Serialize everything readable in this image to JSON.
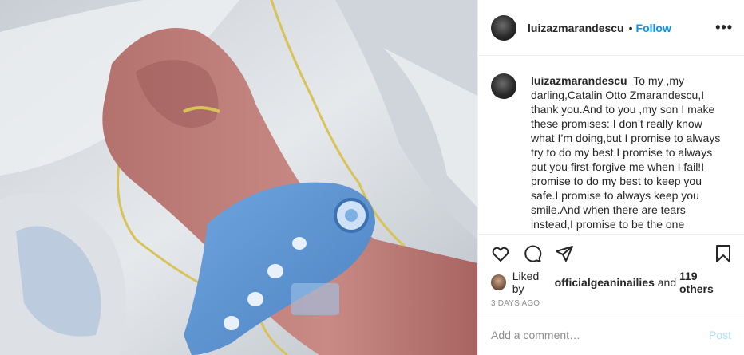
{
  "post": {
    "username": "luizazmarandescu",
    "follow_label": "Follow",
    "separator": "•",
    "more_icon": "more-horizontal-icon",
    "caption_user": "luizazmarandescu",
    "caption_text": "To my ,my darling,Catalin Otto Zmarandescu,I thank you.And to you ,my son I make these promises: I don’t really know what I’m doing,but I promise to always try to do my best.I promise to always put you first-forgive me when I fail!I promise to do my best to keep you safe.I promise to always keep you smile.And when there are tears instead,I promise to be the one",
    "likes_prefix": "Liked by",
    "likes_user": "officialgeaninailies",
    "likes_and": "and",
    "likes_others": "119 others",
    "date": "3 DAYS AGO",
    "comment_placeholder": "Add a comment…",
    "post_button": "Post"
  },
  "icons": {
    "like": "heart-icon",
    "comment": "comment-icon",
    "share": "paper-plane-icon",
    "save": "bookmark-icon"
  },
  "colors": {
    "link_blue": "#0095f6",
    "post_disabled": "#b2dffc",
    "muted": "#8e8e8e"
  }
}
